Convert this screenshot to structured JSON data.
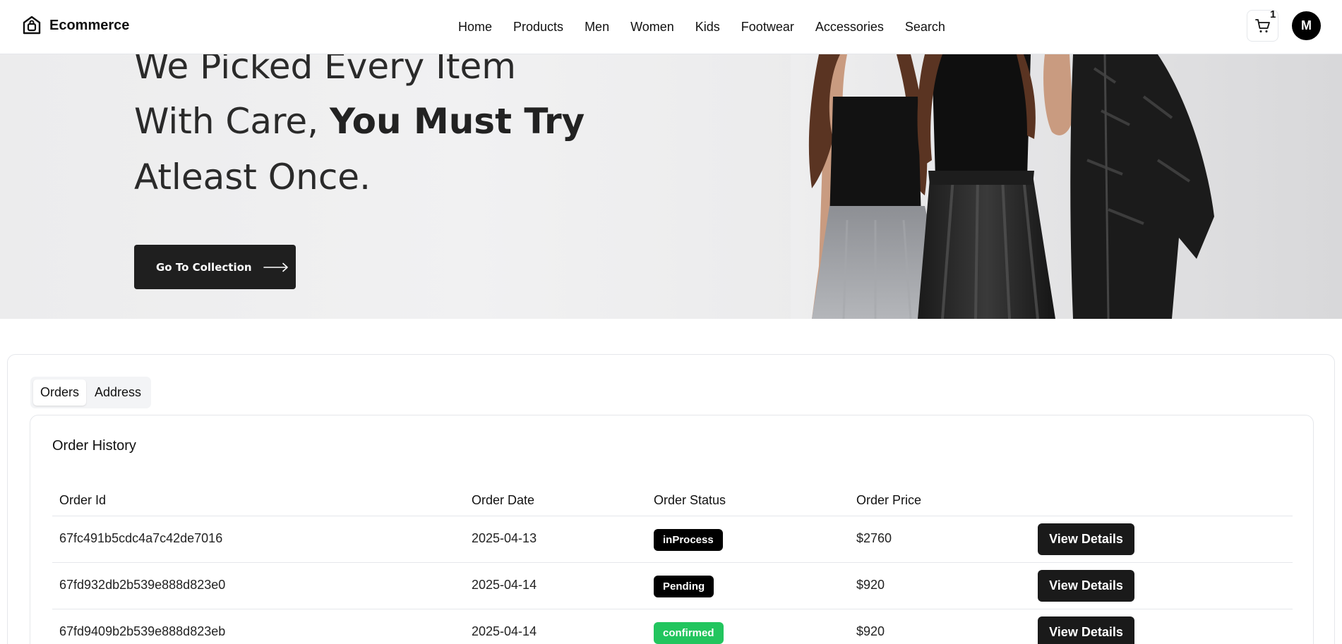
{
  "header": {
    "brand": "Ecommerce",
    "nav": [
      "Home",
      "Products",
      "Men",
      "Women",
      "Kids",
      "Footwear",
      "Accessories",
      "Search"
    ],
    "cart_count": "1",
    "avatar_letter": "M"
  },
  "hero": {
    "line1": "We Picked Every Item",
    "line2_normal": "With Care, ",
    "line2_bold": "You Must Try",
    "line3": "Atleast Once.",
    "cta_label": "Go To Collection"
  },
  "tabs": [
    {
      "label": "Orders",
      "active": true
    },
    {
      "label": "Address",
      "active": false
    }
  ],
  "orders": {
    "title": "Order History",
    "columns": [
      "Order Id",
      "Order Date",
      "Order Status",
      "Order Price",
      ""
    ],
    "view_label": "View Details",
    "rows": [
      {
        "id": "67fc491b5cdc4a7c42de7016",
        "date": "2025-04-13",
        "status": "inProcess",
        "status_color": "#000000",
        "price": "$2760"
      },
      {
        "id": "67fd932db2b539e888d823e0",
        "date": "2025-04-14",
        "status": "Pending",
        "status_color": "#000000",
        "price": "$920"
      },
      {
        "id": "67fd9409b2b539e888d823eb",
        "date": "2025-04-14",
        "status": "confirmed",
        "status_color": "#22c55e",
        "price": "$920"
      }
    ]
  },
  "colors": {
    "primary": "#1a1a1a",
    "confirmed": "#22c55e"
  }
}
